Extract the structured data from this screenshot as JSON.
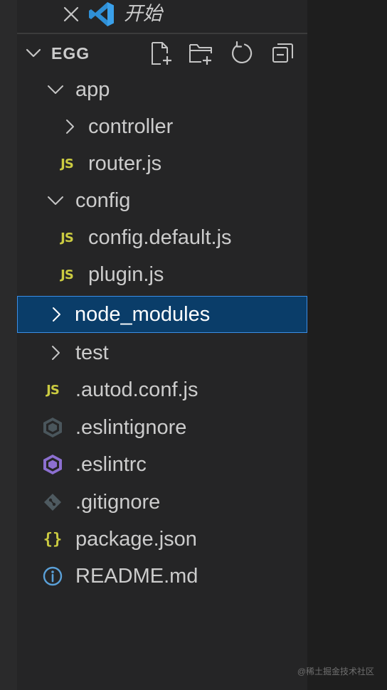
{
  "open_editor": {
    "title": "开始"
  },
  "explorer": {
    "section_title": "EGG",
    "actions": [
      "new-file",
      "new-folder",
      "refresh",
      "collapse-all"
    ]
  },
  "tree": [
    {
      "label": "app",
      "kind": "folder",
      "expanded": true,
      "depth": 1
    },
    {
      "label": "controller",
      "kind": "folder",
      "expanded": false,
      "depth": 2
    },
    {
      "label": "router.js",
      "kind": "js",
      "depth": 2
    },
    {
      "label": "config",
      "kind": "folder",
      "expanded": true,
      "depth": 1
    },
    {
      "label": "config.default.js",
      "kind": "js",
      "depth": 2
    },
    {
      "label": "plugin.js",
      "kind": "js",
      "depth": 2
    },
    {
      "label": "node_modules",
      "kind": "folder",
      "expanded": false,
      "depth": 1,
      "selected": true
    },
    {
      "label": "test",
      "kind": "folder",
      "expanded": false,
      "depth": 1
    },
    {
      "label": ".autod.conf.js",
      "kind": "js",
      "depth": 1
    },
    {
      "label": ".eslintignore",
      "kind": "eslintignore",
      "depth": 1
    },
    {
      "label": ".eslintrc",
      "kind": "eslintrc",
      "depth": 1
    },
    {
      "label": ".gitignore",
      "kind": "git",
      "depth": 1
    },
    {
      "label": "package.json",
      "kind": "json",
      "depth": 1
    },
    {
      "label": "README.md",
      "kind": "info",
      "depth": 1
    }
  ],
  "watermark": "@稀土掘金技术社区",
  "colors": {
    "sidebar_bg": "#252526",
    "selection_bg": "#0a3d69",
    "selection_border": "#3a8ee6",
    "js_icon": "#cbcb41",
    "vscode_blue": "#2f8fd6",
    "eslint_purple": "#8c6fd0",
    "eslint_gray": "#5d6b73",
    "info_blue": "#5aa0d8"
  },
  "icons": {
    "close": "close-icon",
    "app_logo": "vscode-logo-icon",
    "section_chevron": "chevron-down-icon",
    "js": "js-file-icon",
    "json": "json-braces-icon",
    "eslint": "eslint-hexagon-icon",
    "git": "git-diamond-icon",
    "readme": "info-circle-icon"
  }
}
